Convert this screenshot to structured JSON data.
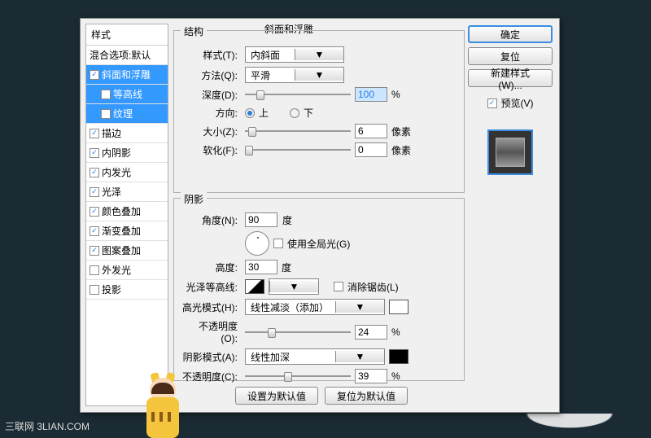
{
  "sidebar": {
    "header": "样式",
    "blend": "混合选项:默认",
    "bevel": "斜面和浮雕",
    "contour": "等高线",
    "texture": "纹理",
    "stroke": "描边",
    "innerShadow": "内阴影",
    "innerGlow": "内发光",
    "satin": "光泽",
    "colorOverlay": "颜色叠加",
    "gradOverlay": "渐变叠加",
    "patternOverlay": "图案叠加",
    "outerGlow": "外发光",
    "dropShadow": "投影"
  },
  "panelTitle": "斜面和浮雕",
  "structure": {
    "group": "结构",
    "styleLbl": "样式(T):",
    "styleVal": "内斜面",
    "techLbl": "方法(Q):",
    "techVal": "平滑",
    "depthLbl": "深度(D):",
    "depthVal": "100",
    "pct": "%",
    "dirLbl": "方向:",
    "up": "上",
    "down": "下",
    "sizeLbl": "大小(Z):",
    "sizeVal": "6",
    "px": "像素",
    "softenLbl": "软化(F):",
    "softenVal": "0"
  },
  "shading": {
    "group": "阴影",
    "angleLbl": "角度(N):",
    "angleVal": "90",
    "deg": "度",
    "globalLight": "使用全局光(G)",
    "altLbl": "高度:",
    "altVal": "30",
    "glossLbl": "光泽等高线:",
    "antiAlias": "消除锯齿(L)",
    "hiModeLbl": "高光模式(H):",
    "hiModeVal": "线性减淡（添加）",
    "opacity1Lbl": "不透明度(O):",
    "opacity1Val": "24",
    "shModeLbl": "阴影模式(A):",
    "shModeVal": "线性加深",
    "opacity2Lbl": "不透明度(C):",
    "opacity2Val": "39"
  },
  "bottom": {
    "setDefault": "设置为默认值",
    "resetDefault": "复位为默认值"
  },
  "right": {
    "ok": "确定",
    "cancel": "复位",
    "newStyle": "新建样式(W)...",
    "previewLbl": "预览(V)"
  },
  "footer": "三联网 3LIAN.COM"
}
